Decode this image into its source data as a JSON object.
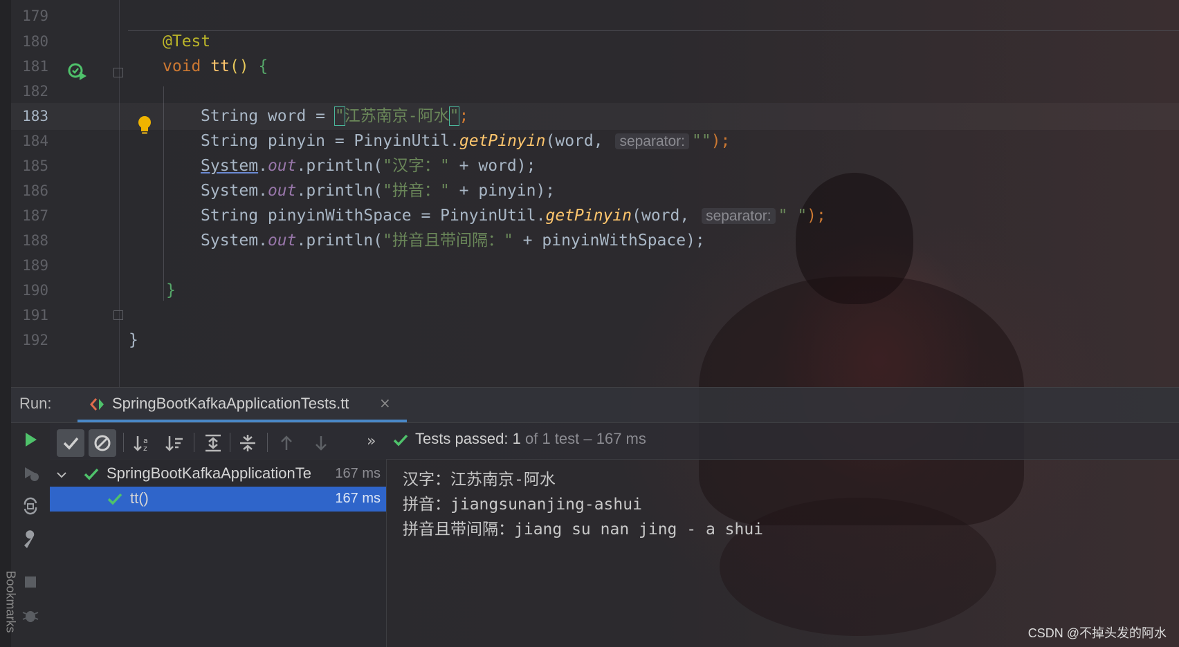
{
  "editor": {
    "lines": [
      {
        "num": "179"
      },
      {
        "num": "180",
        "annotation": "@Test"
      },
      {
        "num": "181",
        "kw": "void",
        "method": "tt",
        "rest": "() ",
        "brace": "{"
      },
      {
        "num": "182"
      },
      {
        "num": "183",
        "p1": "String word = ",
        "quote_open": "\"",
        "str": "江苏南京-阿水",
        "quote_close": "\"",
        "semi": ";"
      },
      {
        "num": "184",
        "p1": "String pinyin = PinyinUtil.",
        "method": "getPinyin",
        "p2": "(word, ",
        "hint": "separator:",
        "str": "\"\"",
        "p3": ");"
      },
      {
        "num": "185",
        "cls": "System",
        "dot": ".",
        "field": "out",
        "p1": ".println(",
        "str": "\"汉字：\"",
        "p2": " + word);"
      },
      {
        "num": "186",
        "cls": "System",
        "dot": ".",
        "field": "out",
        "p1": ".println(",
        "str": "\"拼音：\"",
        "p2": " + pinyin);"
      },
      {
        "num": "187",
        "p1": "String pinyinWithSpace = PinyinUtil.",
        "method": "getPinyin",
        "p2": "(word, ",
        "hint": "separator:",
        "str": "\" \"",
        "p3": ");"
      },
      {
        "num": "188",
        "cls": "System",
        "dot": ".",
        "field": "out",
        "p1": ".println(",
        "str": "\"拼音且带间隔：\"",
        "p2": " + pinyinWithSpace);"
      },
      {
        "num": "189"
      },
      {
        "num": "190",
        "brace": "}"
      },
      {
        "num": "191"
      },
      {
        "num": "192",
        "brace": "}"
      }
    ]
  },
  "run_panel": {
    "label": "Run:",
    "tab_title": "SpringBootKafkaApplicationTests.tt",
    "tab_close": "×",
    "more": "»",
    "status": {
      "prefix": "Tests passed: ",
      "passed": "1",
      "rest": " of 1 test – 167 ms"
    },
    "tree": [
      {
        "label": "SpringBootKafkaApplicationTe",
        "time": "167 ms"
      },
      {
        "label": "tt()",
        "time": "167 ms"
      }
    ],
    "console": [
      "汉字：江苏南京-阿水",
      "拼音：jiangsunanjing-ashui",
      "拼音且带间隔：jiang su nan jing - a shui"
    ]
  },
  "sidebar_label": "Bookmarks",
  "watermark": "CSDN @不掉头发的阿水",
  "colors": {
    "accent": "#4a88c7",
    "success": "#4fc26b",
    "selection": "#2f65ca"
  }
}
